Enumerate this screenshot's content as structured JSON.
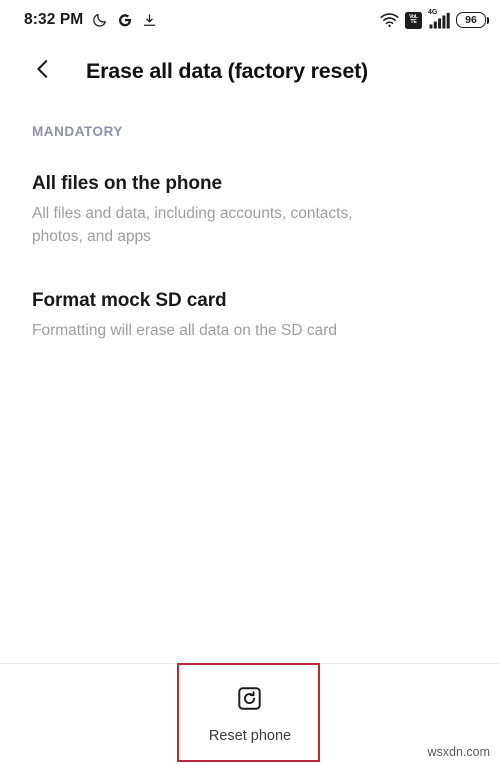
{
  "status_bar": {
    "time": "8:32 PM",
    "left_icons": [
      {
        "name": "moon-icon",
        "label": "Do not disturb"
      },
      {
        "name": "google-icon",
        "label": "G"
      },
      {
        "name": "download-icon",
        "label": "Download"
      }
    ],
    "wifi_icon": "wifi-icon",
    "volte_top": "VoL",
    "volte_bottom": "TE",
    "network_type": "4G",
    "battery_level": "96"
  },
  "app_bar": {
    "back_icon": "back-chevron-icon",
    "title": "Erase all data (factory reset)"
  },
  "content": {
    "section_header": "MANDATORY",
    "items": [
      {
        "title": "All files on the phone",
        "subtitle": "All files and data, including accounts, contacts, photos, and apps"
      },
      {
        "title": "Format mock SD card",
        "subtitle": "Formatting will erase all data on the SD card"
      }
    ]
  },
  "bottom_bar": {
    "reset_icon": "reset-phone-icon",
    "reset_label": "Reset phone"
  },
  "annotation": {
    "color": "#c2263b"
  },
  "watermark": {
    "text": "wsxdn.com"
  }
}
